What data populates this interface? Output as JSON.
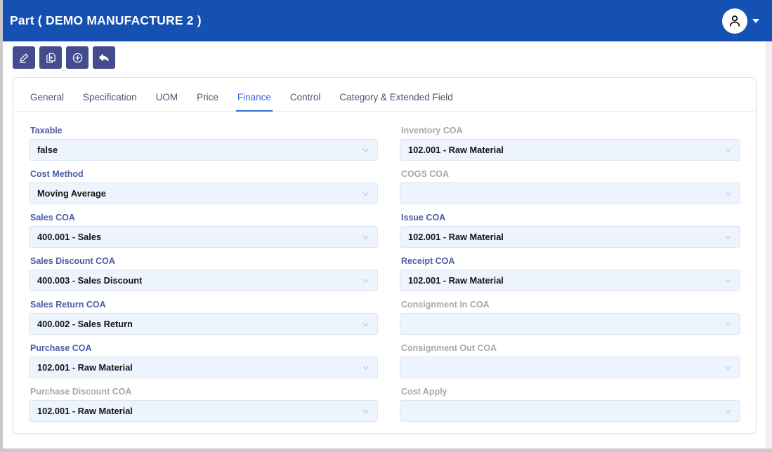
{
  "header": {
    "title": "Part ( DEMO MANUFACTURE 2 )",
    "avatar_icon": "user-icon",
    "caret_icon": "chevron-down-icon",
    "bg_color": "#1550B3"
  },
  "toolbar": {
    "buttons": [
      {
        "name": "edit-button",
        "icon": "pencil-icon"
      },
      {
        "name": "copy-button",
        "icon": "duplicate-document-icon"
      },
      {
        "name": "add-button",
        "icon": "plus-circle-icon"
      },
      {
        "name": "back-button",
        "icon": "back-arrow-icon"
      }
    ],
    "bg_color": "#434C8C"
  },
  "tabs": [
    {
      "label": "General",
      "active": false
    },
    {
      "label": "Specification",
      "active": false
    },
    {
      "label": "UOM",
      "active": false
    },
    {
      "label": "Price",
      "active": false
    },
    {
      "label": "Finance",
      "active": true
    },
    {
      "label": "Control",
      "active": false
    },
    {
      "label": "Category & Extended Field",
      "active": false
    }
  ],
  "active_tab_color": "#2D6AE0",
  "form": {
    "left": [
      {
        "label": "Taxable",
        "value": "false",
        "disabled": false
      },
      {
        "label": "Cost Method",
        "value": "Moving Average",
        "disabled": false
      },
      {
        "label": "Sales COA",
        "value": "400.001 - Sales",
        "disabled": false
      },
      {
        "label": "Sales Discount COA",
        "value": "400.003 - Sales Discount",
        "disabled": false
      },
      {
        "label": "Sales Return COA",
        "value": "400.002 - Sales Return",
        "disabled": false
      },
      {
        "label": "Purchase COA",
        "value": "102.001 - Raw Material",
        "disabled": false
      },
      {
        "label": "Purchase Discount COA",
        "value": "102.001 - Raw Material",
        "disabled": true
      }
    ],
    "right": [
      {
        "label": "Inventory COA",
        "value": "102.001 - Raw Material",
        "disabled": true
      },
      {
        "label": "COGS COA",
        "value": "",
        "disabled": true
      },
      {
        "label": "Issue COA",
        "value": "102.001 - Raw Material",
        "disabled": false
      },
      {
        "label": "Receipt COA",
        "value": "102.001 - Raw Material",
        "disabled": false
      },
      {
        "label": "Consignment In COA",
        "value": "",
        "disabled": true
      },
      {
        "label": "Consignment Out COA",
        "value": "",
        "disabled": true
      },
      {
        "label": "Cost Apply",
        "value": "",
        "disabled": true
      }
    ]
  },
  "colors": {
    "field_bg": "#EDF4FD",
    "field_border": "#DBE5F3",
    "label_active": "#4E5BA6",
    "label_disabled": "#A8A8A8"
  }
}
